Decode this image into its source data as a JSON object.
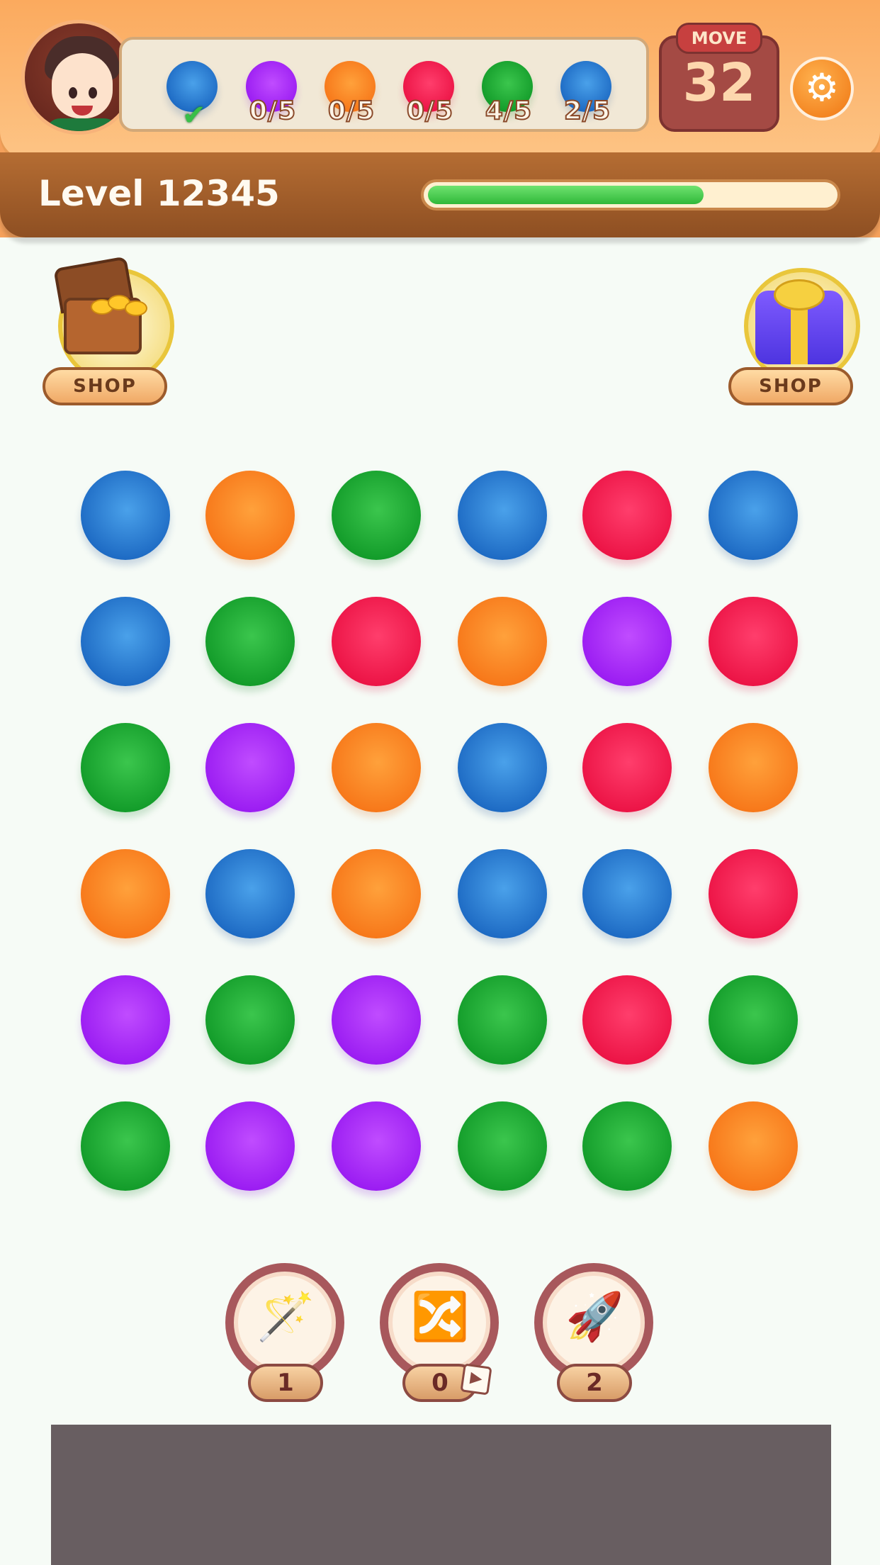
{
  "header": {
    "avatar_name": "player-avatar",
    "move_label": "MOVE",
    "moves_left": "32",
    "level_label": "Level 12345",
    "level_progress": 0.68
  },
  "goals": [
    {
      "color": "blue",
      "count": "",
      "completed": true
    },
    {
      "color": "purple",
      "count": "0/5",
      "completed": false
    },
    {
      "color": "orange",
      "count": "0/5",
      "completed": false
    },
    {
      "color": "red",
      "count": "0/5",
      "completed": false
    },
    {
      "color": "green",
      "count": "4/5",
      "completed": false
    },
    {
      "color": "blue",
      "count": "2/5",
      "completed": false
    }
  ],
  "shops": [
    {
      "name": "treasure-chest",
      "label": "SHOP"
    },
    {
      "name": "gift-box",
      "label": "SHOP"
    }
  ],
  "board": {
    "rows": [
      [
        "blue",
        "orange",
        "green",
        "blue",
        "red",
        "blue"
      ],
      [
        "blue",
        "green",
        "red",
        "orange",
        "purple",
        "red"
      ],
      [
        "green",
        "purple",
        "orange",
        "blue",
        "red",
        "orange"
      ],
      [
        "orange",
        "blue",
        "orange",
        "blue",
        "blue",
        "red"
      ],
      [
        "purple",
        "green",
        "purple",
        "green",
        "red",
        "green"
      ],
      [
        "green",
        "purple",
        "purple",
        "green",
        "green",
        "orange"
      ]
    ]
  },
  "boosters": [
    {
      "name": "magic-wand",
      "count": "1",
      "has_video": false
    },
    {
      "name": "shuffle",
      "count": "0",
      "has_video": true
    },
    {
      "name": "rocket",
      "count": "2",
      "has_video": false
    }
  ],
  "colors": {
    "blue": "#1e6bc4",
    "orange": "#f7781a",
    "green": "#139c2a",
    "red": "#ec1446",
    "purple": "#9b1df2"
  }
}
